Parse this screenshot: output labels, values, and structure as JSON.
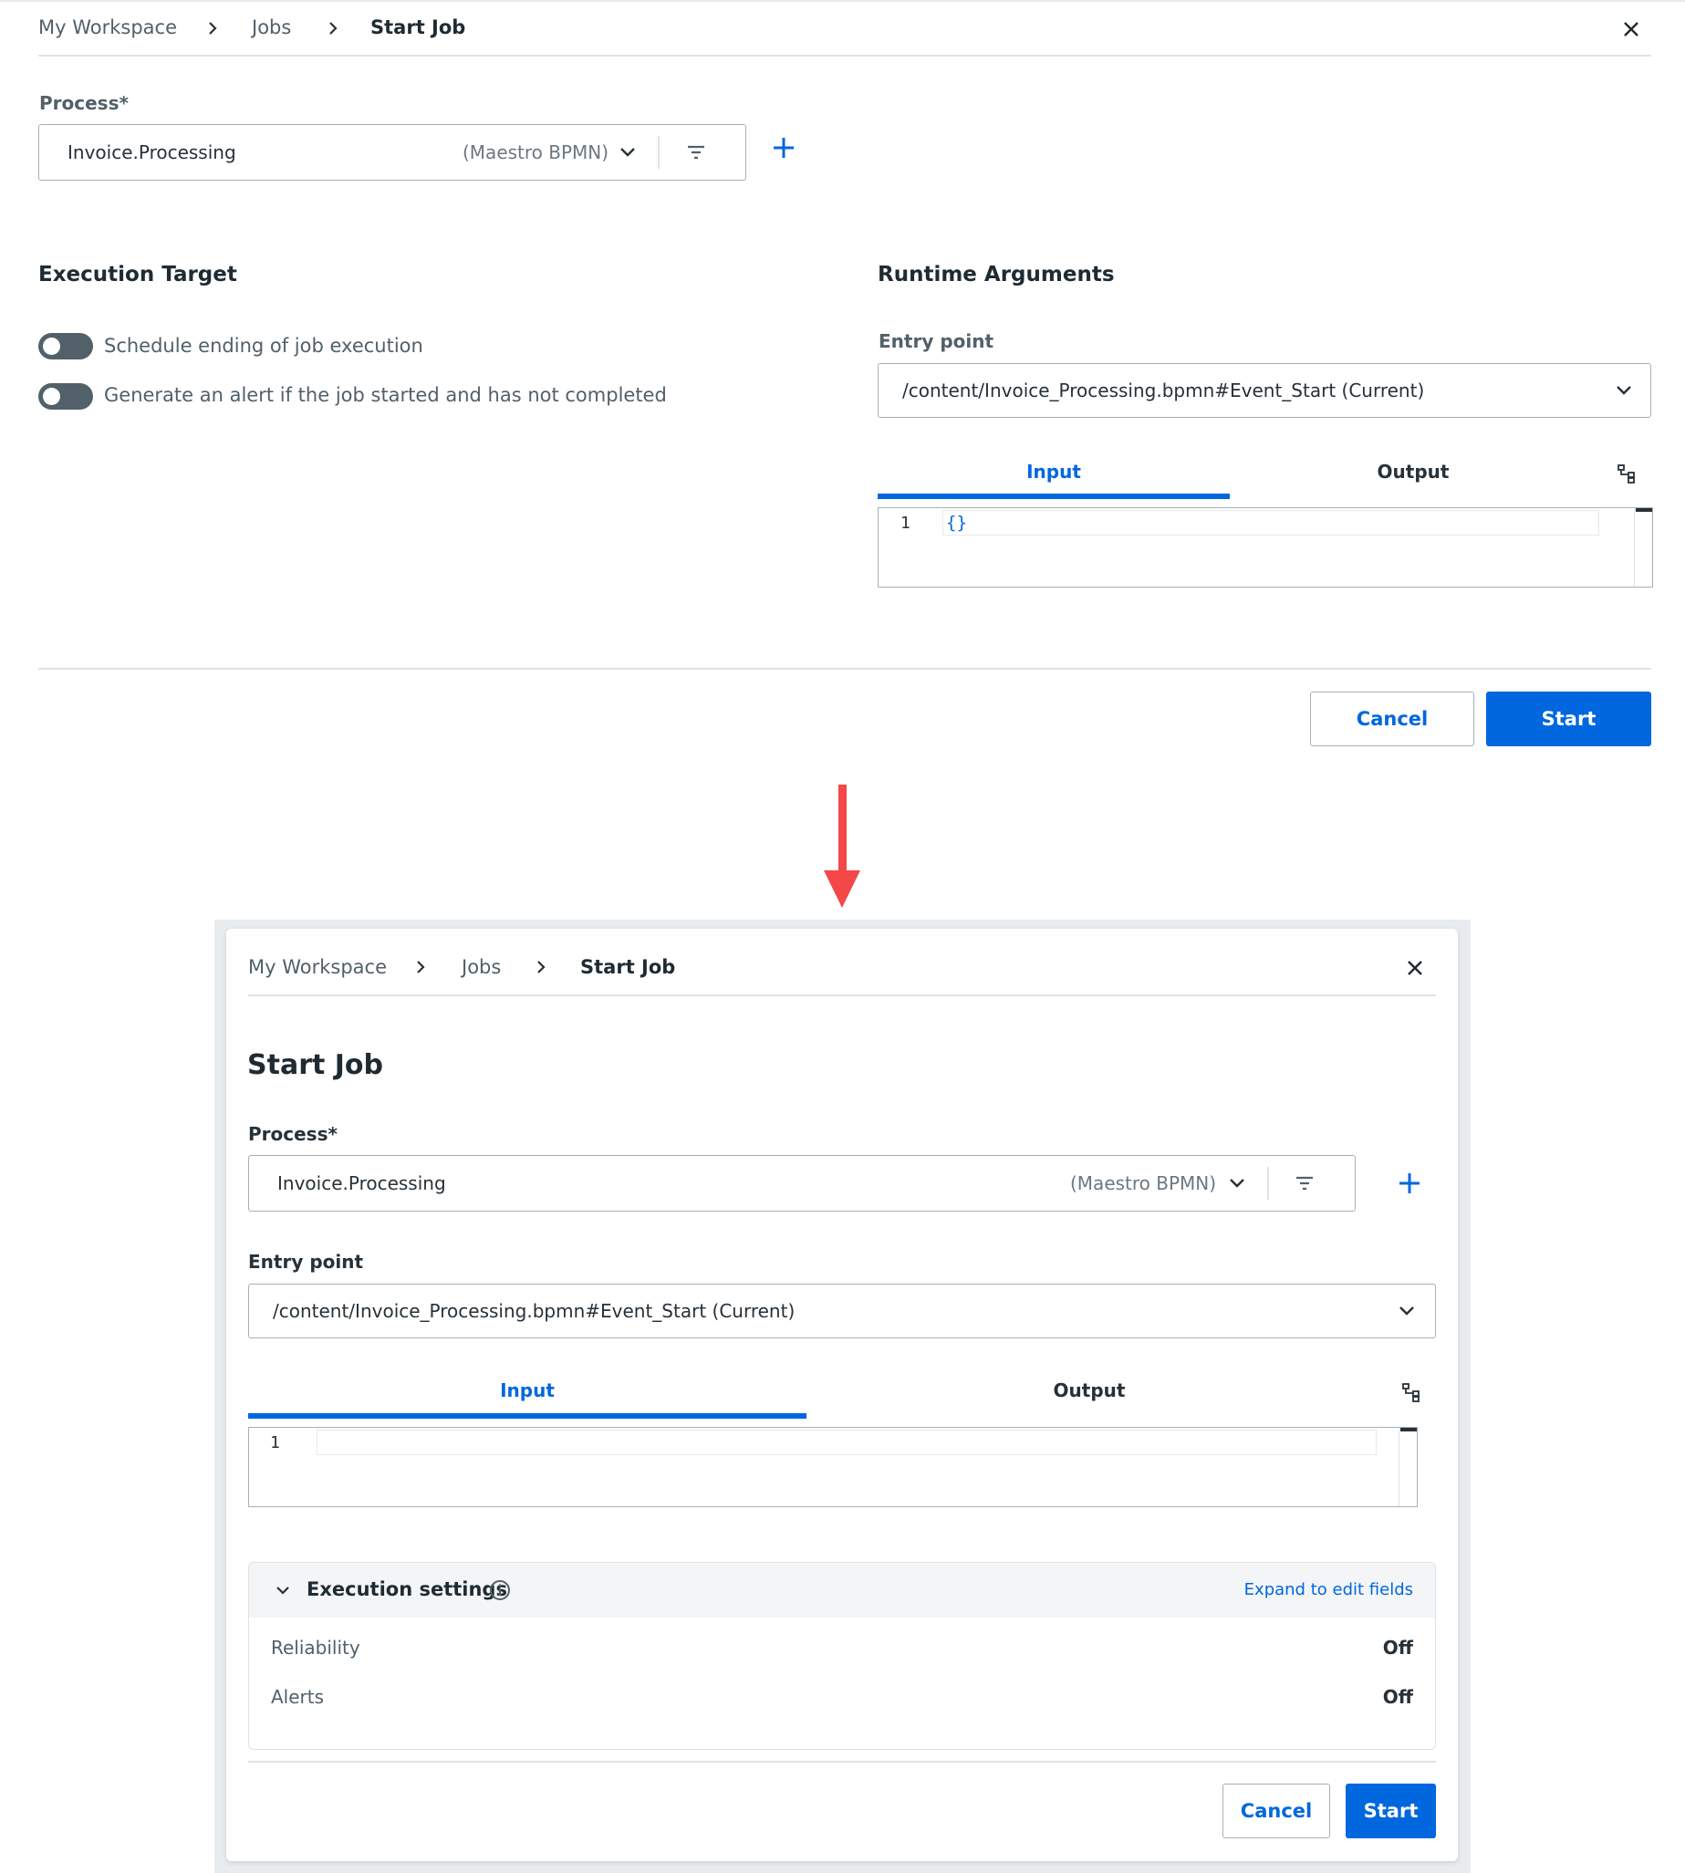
{
  "before": {
    "breadcrumb": [
      "My Workspace",
      "Jobs",
      "Start Job"
    ],
    "process": {
      "label": "Process*",
      "value": "Invoice.Processing",
      "type": "(Maestro BPMN)"
    },
    "execution_target": {
      "title": "Execution Target",
      "toggles": [
        {
          "label": "Schedule ending of job execution",
          "on": false
        },
        {
          "label": "Generate an alert if the job started and has not completed",
          "on": false
        }
      ]
    },
    "runtime_arguments": {
      "title": "Runtime Arguments",
      "entry_point_label": "Entry point",
      "entry_point_value": "/content/Invoice_Processing.bpmn#Event_Start (Current)",
      "tabs": [
        "Input",
        "Output"
      ],
      "active_tab": "Input",
      "editor": {
        "line": "1",
        "content": "{}"
      }
    },
    "buttons": {
      "cancel": "Cancel",
      "start": "Start"
    }
  },
  "after": {
    "breadcrumb": [
      "My Workspace",
      "Jobs",
      "Start Job"
    ],
    "page_title": "Start Job",
    "process": {
      "label": "Process*",
      "value": "Invoice.Processing",
      "type": "(Maestro BPMN)"
    },
    "entry_point_label": "Entry point",
    "entry_point_value": "/content/Invoice_Processing.bpmn#Event_Start (Current)",
    "tabs": [
      "Input",
      "Output"
    ],
    "active_tab": "Input",
    "editor": {
      "line": "1"
    },
    "execution_settings": {
      "title": "Execution settings",
      "expand_link": "Expand to edit fields",
      "rows": [
        {
          "label": "Reliability",
          "value": "Off"
        },
        {
          "label": "Alerts",
          "value": "Off"
        }
      ]
    },
    "buttons": {
      "cancel": "Cancel",
      "start": "Start"
    }
  },
  "colors": {
    "accent": "#0067df",
    "arrow": "#f44747",
    "text": "#273139",
    "border": "#a4b1b8"
  }
}
